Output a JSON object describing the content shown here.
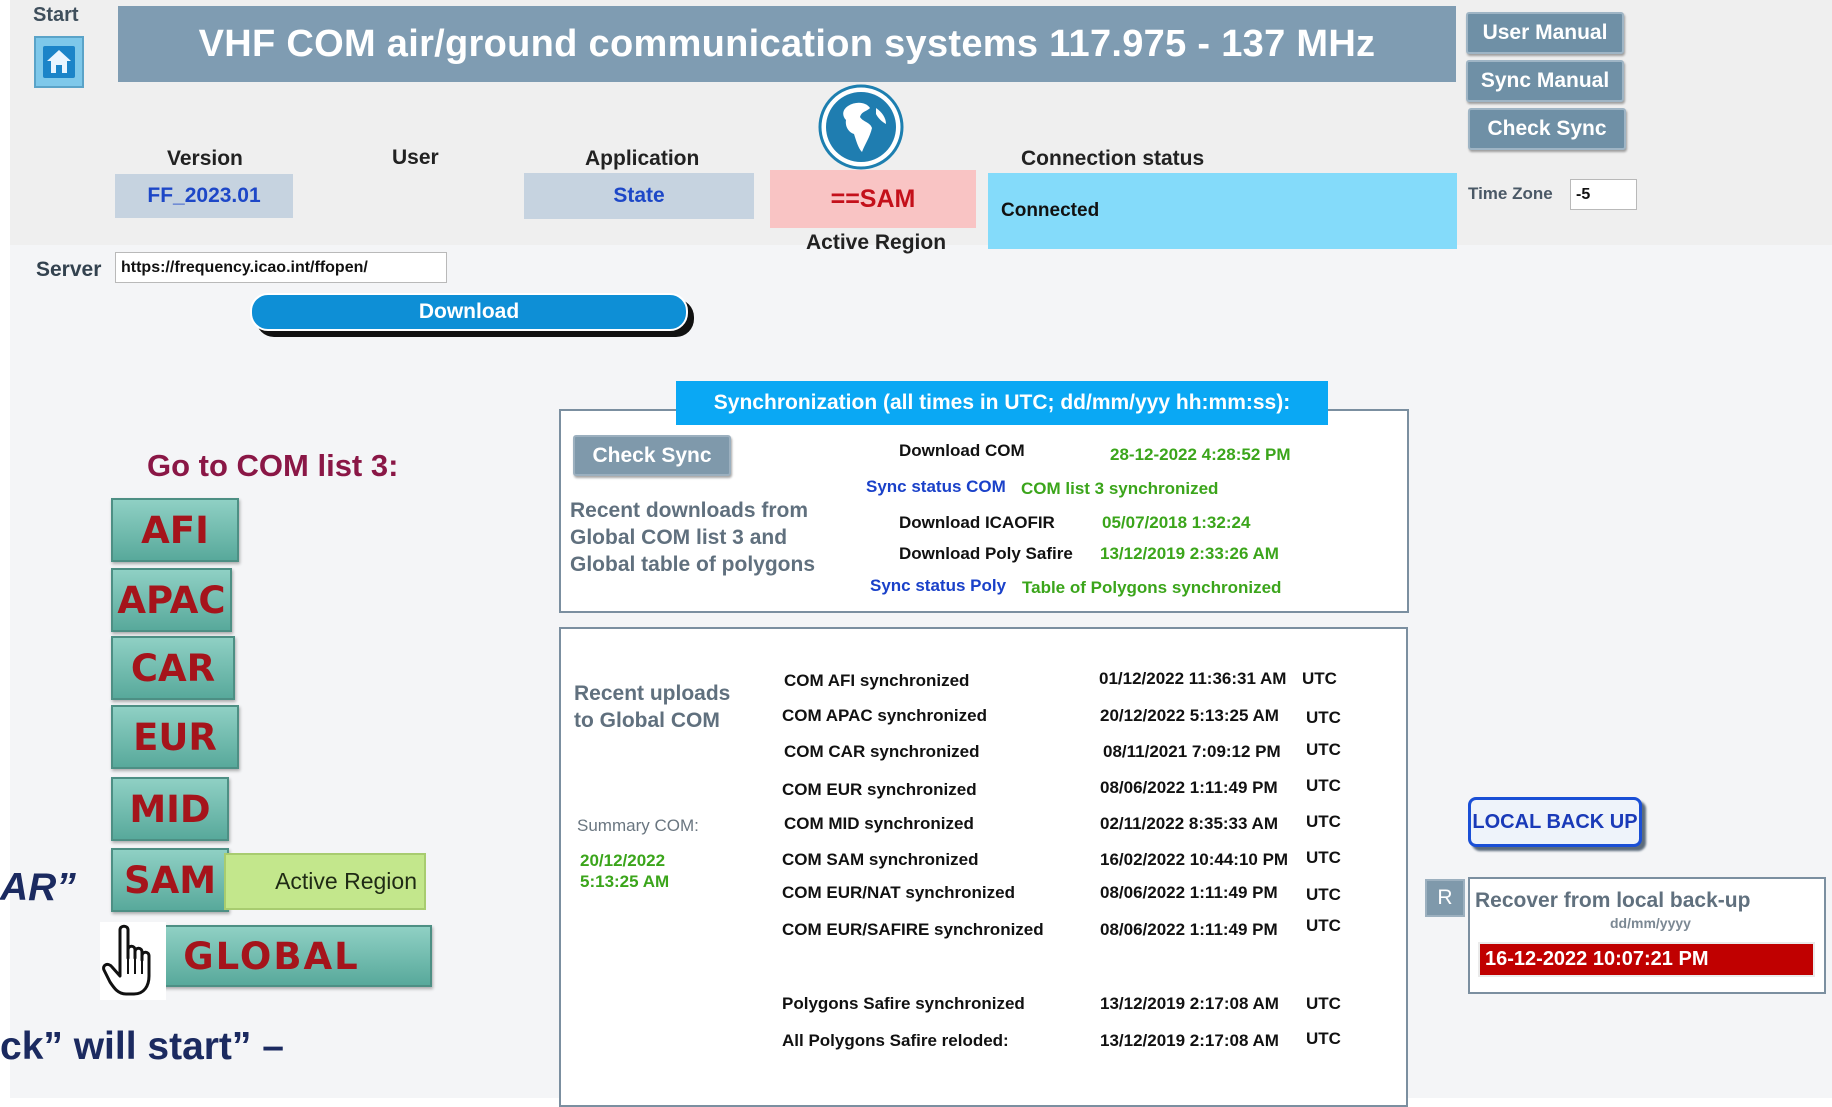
{
  "header": {
    "start_label": "Start",
    "title": "VHF COM air/ground communication systems 117.975 - 137 MHz",
    "buttons": {
      "user_manual": "User Manual",
      "sync_manual": "Sync Manual",
      "check_sync": "Check Sync"
    }
  },
  "info": {
    "version_label": "Version",
    "version_value": "FF_2023.01",
    "user_label": "User",
    "application_label": "Application",
    "application_value": "State",
    "region_value": "==SAM",
    "active_region_label": "Active Region",
    "connection_label": "Connection status",
    "connection_value": "Connected",
    "timezone_label": "Time Zone",
    "timezone_value": "-5"
  },
  "server": {
    "label": "Server",
    "url": "https://frequency.icao.int/ffopen/",
    "download_label": "Download"
  },
  "regions": {
    "heading": "Go to COM list 3:",
    "buttons": [
      "AFI",
      "APAC",
      "CAR",
      "EUR",
      "MID",
      "SAM",
      "GLOBAL"
    ],
    "active_region_tag": "Active Region"
  },
  "sync": {
    "title": "Synchronization (all times in UTC; dd/mm/yyy hh:mm:ss):",
    "check_sync_label": "Check Sync",
    "recent_downloads_text": "Recent downloads from Global COM list 3 and Global table of polygons",
    "download_com_label": "Download COM",
    "download_com_value": "28-12-2022 4:28:52 PM",
    "sync_status_com_label": "Sync status COM",
    "sync_status_com_value": "COM list 3 synchronized",
    "download_icaofir_label": "Download ICAOFIR",
    "download_icaofir_value": "05/07/2018 1:32:24",
    "download_poly_label": "Download Poly Safire",
    "download_poly_value": "13/12/2019 2:33:26 AM",
    "sync_status_poly_label": "Sync status Poly",
    "sync_status_poly_value": "Table of Polygons synchronized"
  },
  "uploads": {
    "heading": "Recent uploads to Global COM",
    "summary_label": "Summary COM:",
    "summary_value": "20/12/2022 5:13:25 AM",
    "rows": [
      {
        "label": "COM AFI synchronized",
        "time": "01/12/2022 11:36:31 AM",
        "tz": "UTC"
      },
      {
        "label": "COM APAC synchronized",
        "time": "20/12/2022 5:13:25 AM",
        "tz": "UTC"
      },
      {
        "label": "COM CAR synchronized",
        "time": "08/11/2021 7:09:12 PM",
        "tz": "UTC"
      },
      {
        "label": "COM EUR synchronized",
        "time": "08/06/2022 1:11:49 PM",
        "tz": "UTC"
      },
      {
        "label": "COM MID synchronized",
        "time": "02/11/2022 8:35:33 AM",
        "tz": "UTC"
      },
      {
        "label": "COM SAM synchronized",
        "time": "16/02/2022 10:44:10 PM",
        "tz": "UTC"
      },
      {
        "label": "COM EUR/NAT synchronized",
        "time": "08/06/2022 1:11:49 PM",
        "tz": "UTC"
      },
      {
        "label": "COM EUR/SAFIRE synchronized",
        "time": "08/06/2022 1:11:49 PM",
        "tz": "UTC"
      },
      {
        "label": "Polygons Safire synchronized",
        "time": "13/12/2019 2:17:08 AM",
        "tz": "UTC"
      },
      {
        "label": "All Polygons Safire reloded:",
        "time": "13/12/2019 2:17:08 AM",
        "tz": "UTC"
      }
    ]
  },
  "backup": {
    "local_backup_label": "LOCAL BACK UP",
    "r_label": "R",
    "recover_label": "Recover from local back-up",
    "format_label": "dd/mm/yyyy",
    "recover_value": "16-12-2022 10:07:21 PM"
  },
  "overlay": {
    "fragment_1": "AR”",
    "fragment_2": "ck” will start” –"
  },
  "colors": {
    "title_bar": "#7f9cb2",
    "region_button": "#58a99b",
    "region_text": "#a5141b",
    "connected_bg": "#84dbfa",
    "sync_title_bg": "#0aa8f4",
    "recover_bg": "#c00000"
  },
  "icons": {
    "home": "home-icon",
    "globe": "globe-icon",
    "hand": "hand-pointer-icon"
  }
}
